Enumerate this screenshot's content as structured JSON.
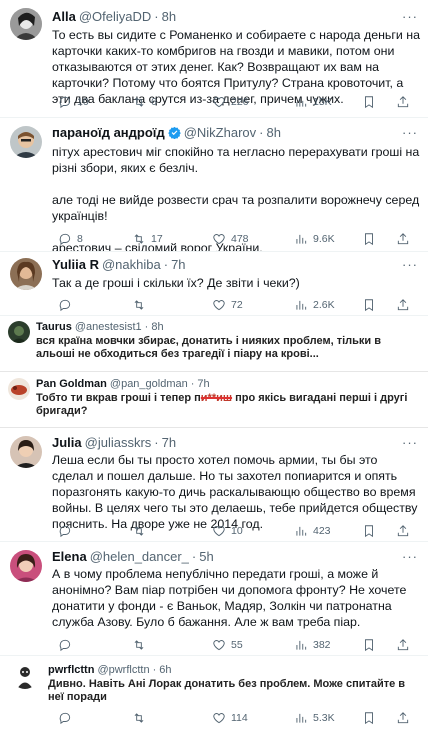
{
  "tweets": {
    "alla": {
      "name": "Alla",
      "handle": "@OfeliyaDD",
      "time": "8h",
      "text": "То есть вы сидите с Романенко и собираете с народа деньги на карточки каких-то комбригов на гвозди и мавики, потом они отказываются от этих денег. Как? Возвращают их вам на карточки? Потому что боятся Притулу? Страна кровоточит, а эти два баклана срутся из-за денег, причем чужих.",
      "replies": "10",
      "reposts": "6",
      "likes": "226",
      "views": "15K"
    },
    "paranoid": {
      "name": "параноїд андроїд",
      "handle": "@NikZharov",
      "time": "8h",
      "text": "пітух арестович міг спокійно та негласно перерахувати гроші на різні збори, яких є безліч.\n\nале тоді не вийде розвести срач та розпалити ворожнечу серед українців!\n\nарестович – свідомий ворог України.",
      "replies": "8",
      "reposts": "17",
      "likes": "478",
      "views": "9.6K"
    },
    "yuliia": {
      "name": "Yuliia R",
      "handle": "@nakhiba",
      "time": "7h",
      "text": "Так а де гроші і скільки їх? Де звіти і чеки?)",
      "replies": "",
      "reposts": "",
      "likes": "72",
      "views": "2.6K"
    },
    "taurus": {
      "name": "Taurus",
      "handle": "@anestesist1",
      "time": "8h",
      "text": "вся країна мовчки збирає, донатить і нияких проблем, тільки в альоші не обходиться без трагедії і піару на крові..."
    },
    "pan": {
      "name": "Pan Goldman",
      "handle": "@pan_goldman",
      "time": "7h",
      "text_before": "Тобто ти вкрав гроші і тепер п",
      "text_struck": "и**иш",
      "text_after": " про якісь вигадані перші і другі бригади?"
    },
    "julia": {
      "name": "Julia",
      "handle": "@juliasskrs",
      "time": "7h",
      "text": "Леша если бы ты просто хотел помочь армии, ты бы это сделал и пошел дальше. Но ты захотел попиарится и опять поразгонять какую-то дичь раскалывающю общество во время войны. В целях чего ты это делаешь, тебе прийдется обществу пояснить. На дворе уже не 2014 год.",
      "replies": "",
      "reposts": "",
      "likes": "10",
      "views": "423"
    },
    "elena": {
      "name": "Elena",
      "handle": "@helen_dancer_",
      "time": "5h",
      "text": "А в чому проблема непублічно передати гроші, а може й анонімно? Вам піар потрібен чи допомога фронту? Не хочете донатити у фонди - є Ваньок, Мадяр, Золкін чи патронатна служба Азову. Було б бажання. Але ж вам треба піар.",
      "replies": "",
      "reposts": "",
      "likes": "55",
      "views": "382"
    },
    "pwr": {
      "name": "pwrflcttn",
      "handle": "@pwrflcttn",
      "time": "6h",
      "text": "Дивно. Навіть Ані Лорак донатить без проблем. Може спитайте в неї поради"
    },
    "last": {
      "likes": "114",
      "views": "5.3K"
    }
  },
  "ui": {
    "more": "···",
    "dot": "·",
    "verified_color": "#1d9bf0",
    "text_color": "#0f1419",
    "muted_color": "#536471"
  }
}
